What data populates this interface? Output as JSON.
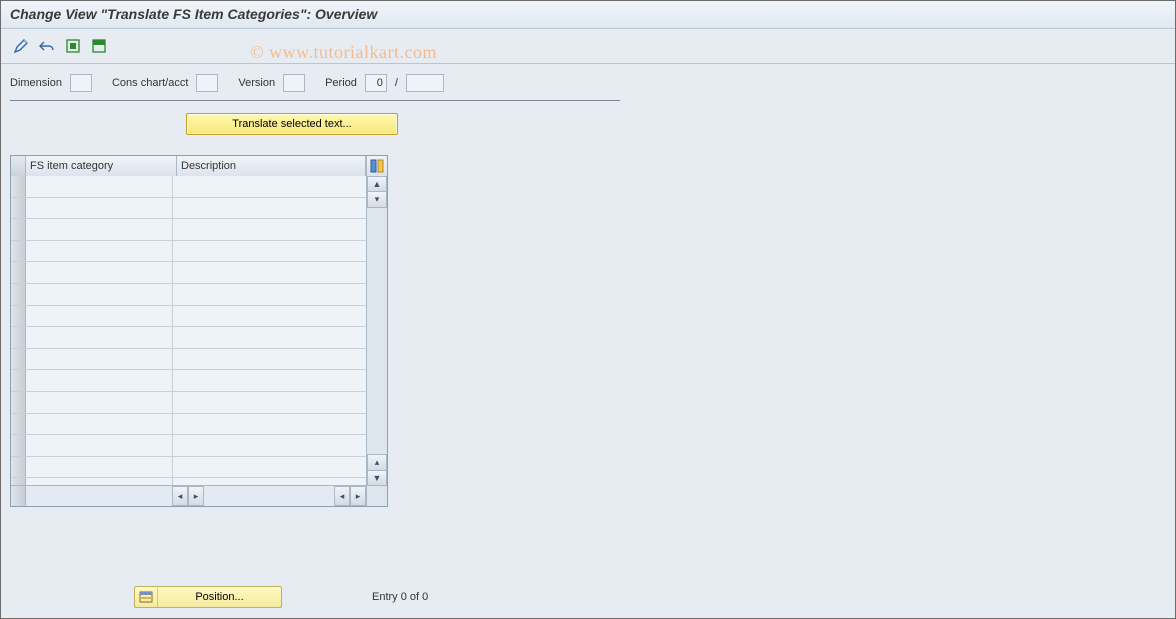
{
  "title": "Change View \"Translate FS Item Categories\": Overview",
  "watermark": "© www.tutorialkart.com",
  "fields": {
    "dimension_label": "Dimension",
    "dimension_value": "",
    "cons_label": "Cons chart/acct",
    "cons_value": "",
    "version_label": "Version",
    "version_value": "",
    "period_label": "Period",
    "period_value": "0",
    "period_sep": "/",
    "year_value": ""
  },
  "buttons": {
    "translate": "Translate selected text...",
    "position": "Position..."
  },
  "table": {
    "col_category": "FS item category",
    "col_description": "Description",
    "row_count": 15
  },
  "footer": {
    "entry": "Entry 0 of 0"
  }
}
